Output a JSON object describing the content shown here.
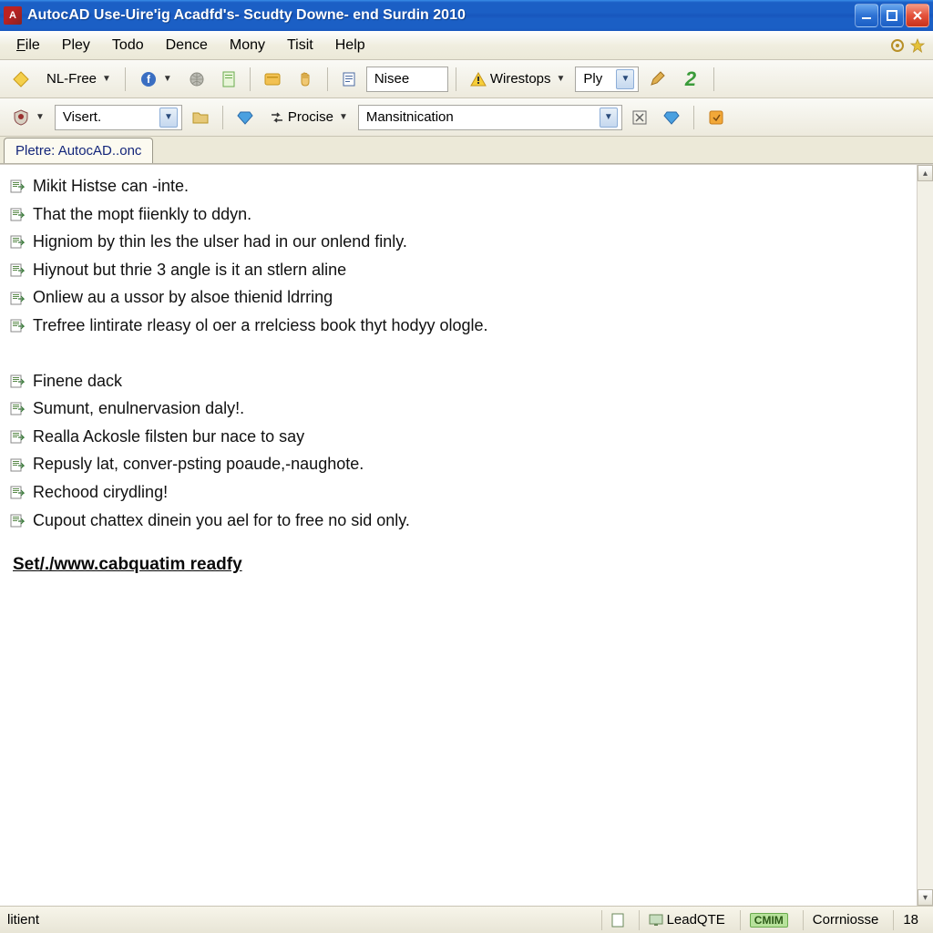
{
  "window": {
    "title": "AutocAD Use-Uire'ig Acadfd's- Scudty Downe- end Surdin 2010"
  },
  "menu": {
    "file": "File",
    "pley": "Pley",
    "todo": "Todo",
    "dence": "Dence",
    "mony": "Mony",
    "tisit": "Tisit",
    "help": "Help"
  },
  "toolbar1": {
    "nlfree": "NL-Free",
    "nisee": "Nisee",
    "wirestops": "Wirestops",
    "ply": "Ply"
  },
  "toolbar2": {
    "visert": "Visert.",
    "procise": "Procise",
    "mansit": "Mansitnication"
  },
  "tab": {
    "label": "Pletre: AutocAD..onc"
  },
  "lines": [
    "Mikit Histse can -inte.",
    "That the mopt fiienkly to ddyn.",
    "Higniom by thin les the ulser had in our onlend finly.",
    "Hiynout but thrie 3 angle is it an stlern aline",
    "Onliew au a ussor by alsoe thienid ldrring",
    "Trefree lintirate rleasy ol oer a rrelciess book thyt hodyy ologle."
  ],
  "lines2": [
    "Finene dack",
    "Sumunt, enulnervasion daly!.",
    "Realla Ackosle filsten bur nace to say",
    "Repusly lat, conver-psting poaude,-naughote.",
    "Rechood cirydling!",
    "Cupout chattex dinein you ael for to free no sid only."
  ],
  "link": "Set/./www.cabquatim readfy",
  "status": {
    "left": "litient",
    "leadqte": "LeadQTE",
    "badge": "CMIM",
    "corr": "Corrniosse",
    "num": "18"
  }
}
